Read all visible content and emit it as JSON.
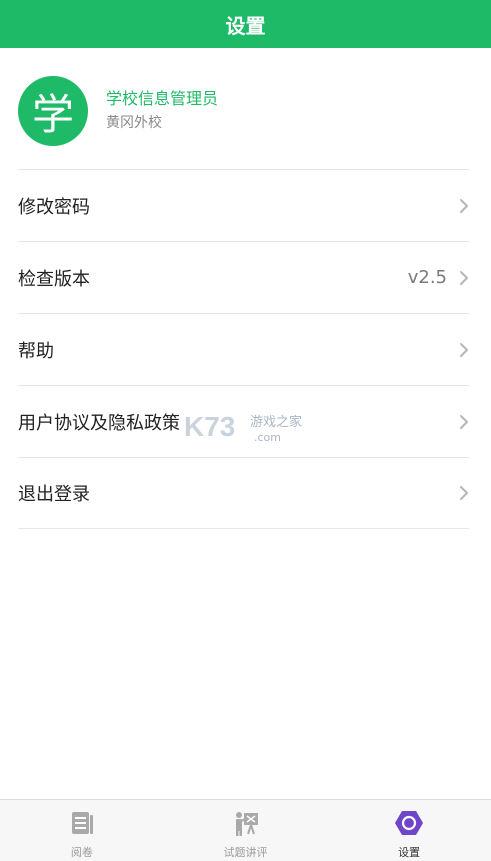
{
  "header": {
    "title": "设置"
  },
  "profile": {
    "avatar_char": "学",
    "name": "学校信息管理员",
    "school": "黄冈外校"
  },
  "menu": [
    {
      "label": "修改密码"
    },
    {
      "label": "检查版本",
      "value": "v2.5"
    },
    {
      "label": "帮助"
    },
    {
      "label": "用户协议及隐私政策"
    },
    {
      "label": "退出登录"
    }
  ],
  "tabs": [
    {
      "label": "阅卷",
      "icon": "paper-icon",
      "active": false
    },
    {
      "label": "试题讲评",
      "icon": "lecture-icon",
      "active": false
    },
    {
      "label": "设置",
      "icon": "settings-hexagon-icon",
      "active": true
    }
  ],
  "watermark": {
    "text": "K73 游戏之家 .com"
  },
  "colors": {
    "brand_green": "#1fba68",
    "active_tab_purple": "#6f45c9"
  }
}
